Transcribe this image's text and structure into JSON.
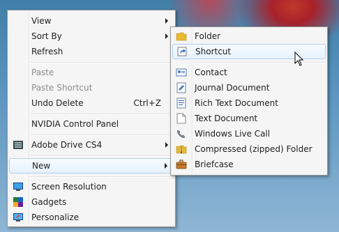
{
  "main_menu": {
    "items": {
      "view": {
        "label": "View"
      },
      "sort_by": {
        "label": "Sort By"
      },
      "refresh": {
        "label": "Refresh"
      },
      "paste": {
        "label": "Paste"
      },
      "paste_shortcut": {
        "label": "Paste Shortcut"
      },
      "undo_delete": {
        "label": "Undo Delete",
        "shortcut": "Ctrl+Z"
      },
      "nvidia": {
        "label": "NVIDIA Control Panel"
      },
      "adobe_drive": {
        "label": "Adobe Drive CS4"
      },
      "new": {
        "label": "New"
      },
      "screen_resolution": {
        "label": "Screen Resolution"
      },
      "gadgets": {
        "label": "Gadgets"
      },
      "personalize": {
        "label": "Personalize"
      }
    }
  },
  "new_submenu": {
    "items": {
      "folder": {
        "label": "Folder",
        "icon": "folder-icon"
      },
      "shortcut": {
        "label": "Shortcut",
        "icon": "shortcut-icon"
      },
      "contact": {
        "label": "Contact",
        "icon": "contact-icon"
      },
      "journal": {
        "label": "Journal Document",
        "icon": "journal-icon"
      },
      "rich_text": {
        "label": "Rich Text Document",
        "icon": "rich-text-icon"
      },
      "text": {
        "label": "Text Document",
        "icon": "text-document-icon"
      },
      "live_call": {
        "label": "Windows Live Call",
        "icon": "phone-icon"
      },
      "zip": {
        "label": "Compressed (zipped) Folder",
        "icon": "zip-folder-icon"
      },
      "briefcase": {
        "label": "Briefcase",
        "icon": "briefcase-icon"
      }
    }
  },
  "colors": {
    "highlight_border": "#b0cfef",
    "menu_bg": "#f5f5f5",
    "disabled_text": "#8d8d8d"
  }
}
